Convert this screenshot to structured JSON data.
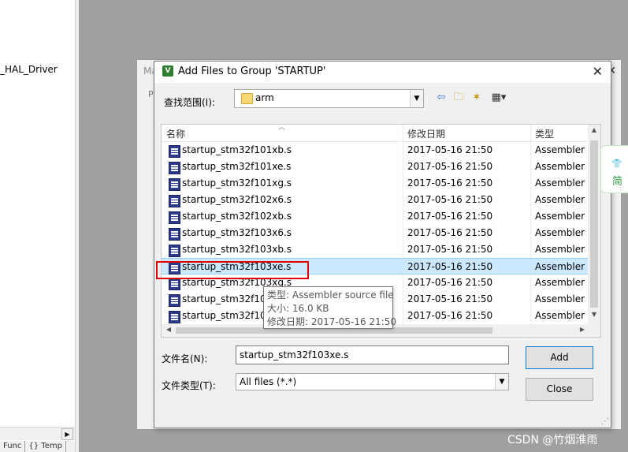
{
  "left_panel": {
    "tree_item": "_HAL_Driver",
    "bottom_tabs": [
      "Func",
      "{} Temp"
    ]
  },
  "bg_dialog": {
    "title": "Ma",
    "sub": "Pr"
  },
  "dialog": {
    "title": "Add Files to Group 'STARTUP'",
    "look_in_label": "查找范围(I):",
    "look_in_value": "arm",
    "columns": {
      "name": "名称",
      "date": "修改日期",
      "type": "类型"
    },
    "files": [
      {
        "name": "startup_stm32f101xb.s",
        "date": "2017-05-16 21:50",
        "type": "Assembler s"
      },
      {
        "name": "startup_stm32f101xe.s",
        "date": "2017-05-16 21:50",
        "type": "Assembler s"
      },
      {
        "name": "startup_stm32f101xg.s",
        "date": "2017-05-16 21:50",
        "type": "Assembler s"
      },
      {
        "name": "startup_stm32f102x6.s",
        "date": "2017-05-16 21:50",
        "type": "Assembler s"
      },
      {
        "name": "startup_stm32f102xb.s",
        "date": "2017-05-16 21:50",
        "type": "Assembler s"
      },
      {
        "name": "startup_stm32f103x6.s",
        "date": "2017-05-16 21:50",
        "type": "Assembler s"
      },
      {
        "name": "startup_stm32f103xb.s",
        "date": "2017-05-16 21:50",
        "type": "Assembler s"
      },
      {
        "name": "startup_stm32f103xe.s",
        "date": "2017-05-16 21:50",
        "type": "Assembler s",
        "selected": true
      },
      {
        "name": "startup_stm32f103xg.s",
        "date": "2017-05-16 21:50",
        "type": "Assembler s"
      },
      {
        "name": "startup_stm32f105",
        "date": "2017-05-16 21:50",
        "type": "Assembler s"
      },
      {
        "name": "startup_stm32f107",
        "date": "2017-05-16 21:50",
        "type": "Assembler s"
      }
    ],
    "tooltip": {
      "type": "类型: Assembler source file",
      "size": "大小: 16.0 KB",
      "modified": "修改日期: 2017-05-16 21:50"
    },
    "file_name_label": "文件名(N):",
    "file_name_value": "startup_stm32f103xe.s",
    "file_type_label": "文件类型(T):",
    "file_type_value": "All files (*.*)",
    "add_label": "Add",
    "close_label": "Close"
  },
  "side_widget": {
    "text": "简"
  },
  "watermark": "CSDN @竹烟淮雨",
  "colors": {
    "selection": "#cce8ff",
    "highlight_box": "#e00000",
    "accent": "#0078d7"
  },
  "icons": [
    "folder-icon",
    "back-icon",
    "up-folder-icon",
    "new-folder-icon",
    "view-menu-icon",
    "file-asm-icon",
    "close-icon"
  ]
}
